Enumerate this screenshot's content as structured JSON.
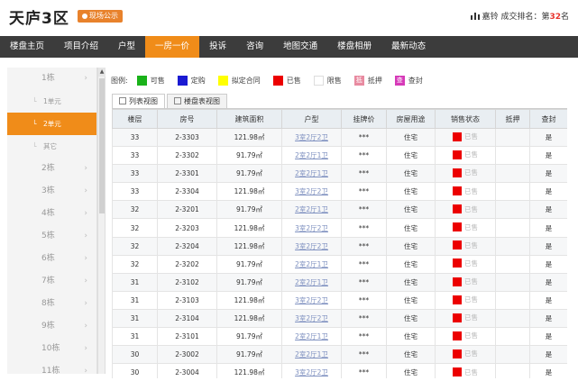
{
  "header": {
    "title": "天庐3区",
    "badge": "现场公示",
    "rank_prefix": "嘉铃 成交排名：第",
    "rank_num": "32",
    "rank_suffix": "名"
  },
  "nav": [
    "楼盘主页",
    "项目介绍",
    "户型",
    "一房一价",
    "投诉",
    "咨询",
    "地图交通",
    "楼盘相册",
    "最新动态"
  ],
  "nav_active": 3,
  "sidebar": [
    {
      "label": "1栋",
      "type": "main"
    },
    {
      "label": "1单元",
      "type": "sub"
    },
    {
      "label": "2单元",
      "type": "sub",
      "active": true
    },
    {
      "label": "其它",
      "type": "sub"
    },
    {
      "label": "2栋",
      "type": "main"
    },
    {
      "label": "3栋",
      "type": "main"
    },
    {
      "label": "4栋",
      "type": "main"
    },
    {
      "label": "5栋",
      "type": "main"
    },
    {
      "label": "6栋",
      "type": "main"
    },
    {
      "label": "7栋",
      "type": "main"
    },
    {
      "label": "8栋",
      "type": "main"
    },
    {
      "label": "9栋",
      "type": "main"
    },
    {
      "label": "10栋",
      "type": "main"
    },
    {
      "label": "11栋",
      "type": "main"
    }
  ],
  "legend": {
    "label": "图例:",
    "items": [
      {
        "label": "可售",
        "color": "#1ab21a"
      },
      {
        "label": "定购",
        "color": "#1a1ad2"
      },
      {
        "label": "拟定合同",
        "color": "#ffff00"
      },
      {
        "label": "已售",
        "color": "#ec0000"
      },
      {
        "label": "限售",
        "color": "#ffffff"
      },
      {
        "label": "抵押",
        "color": "#e88aa0",
        "glyph": "抵"
      },
      {
        "label": "查封",
        "color": "#d63ab8",
        "glyph": "查"
      }
    ]
  },
  "tabs": [
    "列表视图",
    "楼盘表视图"
  ],
  "table": {
    "headers": [
      "楼层",
      "房号",
      "建筑面积",
      "户型",
      "挂牌价",
      "房屋用途",
      "销售状态",
      "抵押",
      "查封"
    ],
    "rows": [
      [
        "33",
        "2-3303",
        "121.98㎡",
        "3室2厅2卫",
        "***",
        "住宅",
        "已售",
        "",
        "是"
      ],
      [
        "33",
        "2-3302",
        "91.79㎡",
        "2室2厅1卫",
        "***",
        "住宅",
        "已售",
        "",
        "是"
      ],
      [
        "33",
        "2-3301",
        "91.79㎡",
        "2室2厅1卫",
        "***",
        "住宅",
        "已售",
        "",
        "是"
      ],
      [
        "33",
        "2-3304",
        "121.98㎡",
        "3室2厅2卫",
        "***",
        "住宅",
        "已售",
        "",
        "是"
      ],
      [
        "32",
        "2-3201",
        "91.79㎡",
        "2室2厅1卫",
        "***",
        "住宅",
        "已售",
        "",
        "是"
      ],
      [
        "32",
        "2-3203",
        "121.98㎡",
        "3室2厅2卫",
        "***",
        "住宅",
        "已售",
        "",
        "是"
      ],
      [
        "32",
        "2-3204",
        "121.98㎡",
        "3室2厅2卫",
        "***",
        "住宅",
        "已售",
        "",
        "是"
      ],
      [
        "32",
        "2-3202",
        "91.79㎡",
        "2室2厅1卫",
        "***",
        "住宅",
        "已售",
        "",
        "是"
      ],
      [
        "31",
        "2-3102",
        "91.79㎡",
        "2室2厅1卫",
        "***",
        "住宅",
        "已售",
        "",
        "是"
      ],
      [
        "31",
        "2-3103",
        "121.98㎡",
        "3室2厅2卫",
        "***",
        "住宅",
        "已售",
        "",
        "是"
      ],
      [
        "31",
        "2-3104",
        "121.98㎡",
        "3室2厅2卫",
        "***",
        "住宅",
        "已售",
        "",
        "是"
      ],
      [
        "31",
        "2-3101",
        "91.79㎡",
        "2室2厅1卫",
        "***",
        "住宅",
        "已售",
        "",
        "是"
      ],
      [
        "30",
        "2-3002",
        "91.79㎡",
        "2室2厅1卫",
        "***",
        "住宅",
        "已售",
        "",
        "是"
      ],
      [
        "30",
        "2-3004",
        "121.98㎡",
        "3室2厅2卫",
        "***",
        "住宅",
        "已售",
        "",
        "是"
      ]
    ]
  }
}
